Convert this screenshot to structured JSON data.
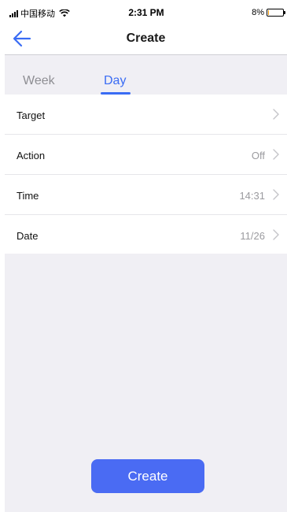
{
  "status_bar": {
    "carrier": "中国移动",
    "time": "2:31 PM",
    "battery_percent": "8%",
    "battery_level": 0.08,
    "battery_color": "#ff9500"
  },
  "nav": {
    "title": "Create",
    "back_icon": "arrow-left-icon"
  },
  "tabs": [
    {
      "label": "Week",
      "active": false
    },
    {
      "label": "Day",
      "active": true
    }
  ],
  "list": {
    "items": [
      {
        "label": "Target",
        "value": ""
      },
      {
        "label": "Action",
        "value": "Off"
      },
      {
        "label": "Time",
        "value": "14:31"
      },
      {
        "label": "Date",
        "value": "11/26"
      }
    ]
  },
  "actions": {
    "create_label": "Create"
  },
  "colors": {
    "accent": "#3a6cf4",
    "button": "#4a6bf3",
    "background": "#f0eff4"
  }
}
